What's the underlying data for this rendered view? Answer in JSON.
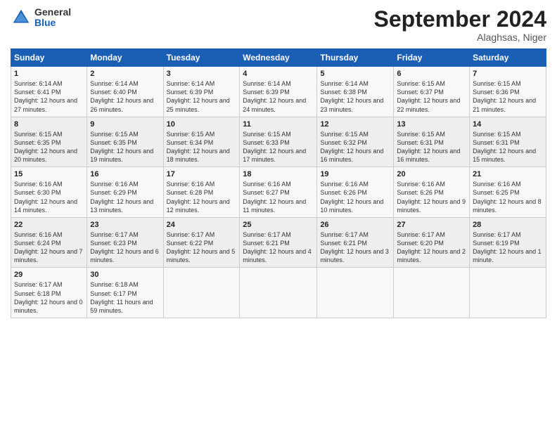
{
  "header": {
    "logo_general": "General",
    "logo_blue": "Blue",
    "month_title": "September 2024",
    "location": "Alaghsas, Niger"
  },
  "weekdays": [
    "Sunday",
    "Monday",
    "Tuesday",
    "Wednesday",
    "Thursday",
    "Friday",
    "Saturday"
  ],
  "weeks": [
    [
      {
        "day": "1",
        "rise": "6:14 AM",
        "set": "6:41 PM",
        "daylight": "12 hours and 27 minutes."
      },
      {
        "day": "2",
        "rise": "6:14 AM",
        "set": "6:40 PM",
        "daylight": "12 hours and 26 minutes."
      },
      {
        "day": "3",
        "rise": "6:14 AM",
        "set": "6:39 PM",
        "daylight": "12 hours and 25 minutes."
      },
      {
        "day": "4",
        "rise": "6:14 AM",
        "set": "6:39 PM",
        "daylight": "12 hours and 24 minutes."
      },
      {
        "day": "5",
        "rise": "6:14 AM",
        "set": "6:38 PM",
        "daylight": "12 hours and 23 minutes."
      },
      {
        "day": "6",
        "rise": "6:15 AM",
        "set": "6:37 PM",
        "daylight": "12 hours and 22 minutes."
      },
      {
        "day": "7",
        "rise": "6:15 AM",
        "set": "6:36 PM",
        "daylight": "12 hours and 21 minutes."
      }
    ],
    [
      {
        "day": "8",
        "rise": "6:15 AM",
        "set": "6:35 PM",
        "daylight": "12 hours and 20 minutes."
      },
      {
        "day": "9",
        "rise": "6:15 AM",
        "set": "6:35 PM",
        "daylight": "12 hours and 19 minutes."
      },
      {
        "day": "10",
        "rise": "6:15 AM",
        "set": "6:34 PM",
        "daylight": "12 hours and 18 minutes."
      },
      {
        "day": "11",
        "rise": "6:15 AM",
        "set": "6:33 PM",
        "daylight": "12 hours and 17 minutes."
      },
      {
        "day": "12",
        "rise": "6:15 AM",
        "set": "6:32 PM",
        "daylight": "12 hours and 16 minutes."
      },
      {
        "day": "13",
        "rise": "6:15 AM",
        "set": "6:31 PM",
        "daylight": "12 hours and 16 minutes."
      },
      {
        "day": "14",
        "rise": "6:15 AM",
        "set": "6:31 PM",
        "daylight": "12 hours and 15 minutes."
      }
    ],
    [
      {
        "day": "15",
        "rise": "6:16 AM",
        "set": "6:30 PM",
        "daylight": "12 hours and 14 minutes."
      },
      {
        "day": "16",
        "rise": "6:16 AM",
        "set": "6:29 PM",
        "daylight": "12 hours and 13 minutes."
      },
      {
        "day": "17",
        "rise": "6:16 AM",
        "set": "6:28 PM",
        "daylight": "12 hours and 12 minutes."
      },
      {
        "day": "18",
        "rise": "6:16 AM",
        "set": "6:27 PM",
        "daylight": "12 hours and 11 minutes."
      },
      {
        "day": "19",
        "rise": "6:16 AM",
        "set": "6:26 PM",
        "daylight": "12 hours and 10 minutes."
      },
      {
        "day": "20",
        "rise": "6:16 AM",
        "set": "6:26 PM",
        "daylight": "12 hours and 9 minutes."
      },
      {
        "day": "21",
        "rise": "6:16 AM",
        "set": "6:25 PM",
        "daylight": "12 hours and 8 minutes."
      }
    ],
    [
      {
        "day": "22",
        "rise": "6:16 AM",
        "set": "6:24 PM",
        "daylight": "12 hours and 7 minutes."
      },
      {
        "day": "23",
        "rise": "6:17 AM",
        "set": "6:23 PM",
        "daylight": "12 hours and 6 minutes."
      },
      {
        "day": "24",
        "rise": "6:17 AM",
        "set": "6:22 PM",
        "daylight": "12 hours and 5 minutes."
      },
      {
        "day": "25",
        "rise": "6:17 AM",
        "set": "6:21 PM",
        "daylight": "12 hours and 4 minutes."
      },
      {
        "day": "26",
        "rise": "6:17 AM",
        "set": "6:21 PM",
        "daylight": "12 hours and 3 minutes."
      },
      {
        "day": "27",
        "rise": "6:17 AM",
        "set": "6:20 PM",
        "daylight": "12 hours and 2 minutes."
      },
      {
        "day": "28",
        "rise": "6:17 AM",
        "set": "6:19 PM",
        "daylight": "12 hours and 1 minute."
      }
    ],
    [
      {
        "day": "29",
        "rise": "6:17 AM",
        "set": "6:18 PM",
        "daylight": "12 hours and 0 minutes."
      },
      {
        "day": "30",
        "rise": "6:18 AM",
        "set": "6:17 PM",
        "daylight": "11 hours and 59 minutes."
      },
      null,
      null,
      null,
      null,
      null
    ]
  ],
  "labels": {
    "sunrise": "Sunrise:",
    "sunset": "Sunset:",
    "daylight": "Daylight:"
  }
}
